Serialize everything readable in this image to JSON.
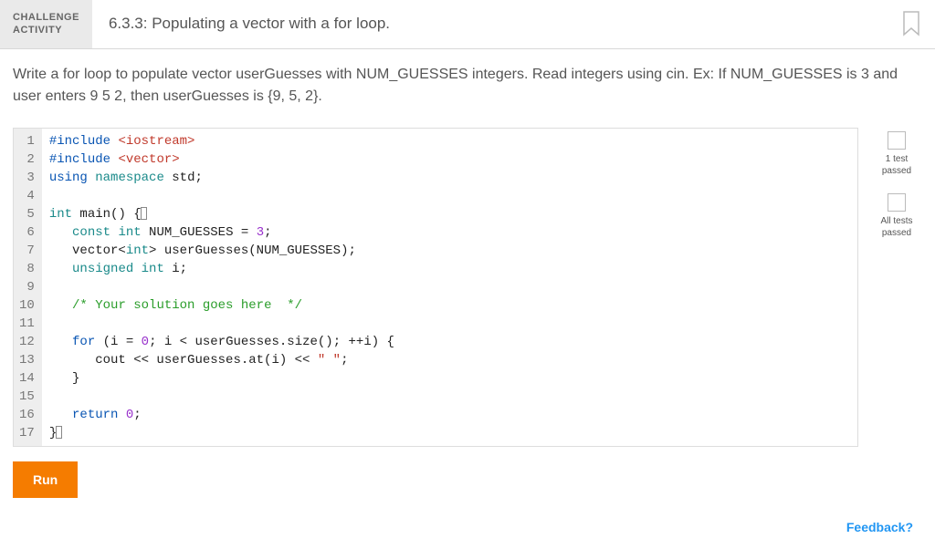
{
  "header": {
    "challenge_label_line1": "CHALLENGE",
    "challenge_label_line2": "ACTIVITY",
    "title": "6.3.3: Populating a vector with a for loop."
  },
  "instructions": "Write a for loop to populate vector userGuesses with NUM_GUESSES integers. Read integers using cin. Ex: If NUM_GUESSES is 3 and user enters 9 5 2, then userGuesses is {9, 5, 2}.",
  "code": {
    "lines": [
      {
        "n": 1,
        "tokens": [
          [
            "#include ",
            "kw-blue"
          ],
          [
            "<iostream>",
            "str-red"
          ]
        ]
      },
      {
        "n": 2,
        "tokens": [
          [
            "#include ",
            "kw-blue"
          ],
          [
            "<vector>",
            "str-red"
          ]
        ]
      },
      {
        "n": 3,
        "tokens": [
          [
            "using ",
            "kw-blue"
          ],
          [
            "namespace",
            "kw-teal"
          ],
          [
            " std;",
            ""
          ]
        ]
      },
      {
        "n": 4,
        "tokens": [
          [
            "",
            ""
          ]
        ]
      },
      {
        "n": 5,
        "tokens": [
          [
            "int",
            "kw-teal"
          ],
          [
            " main() {",
            ""
          ]
        ],
        "cursor_after_brace": true
      },
      {
        "n": 6,
        "tokens": [
          [
            "   ",
            ""
          ],
          [
            "const int",
            "kw-teal"
          ],
          [
            " NUM_GUESSES = ",
            ""
          ],
          [
            "3",
            "lit-purple"
          ],
          [
            ";",
            ""
          ]
        ]
      },
      {
        "n": 7,
        "tokens": [
          [
            "   vector<",
            ""
          ],
          [
            "int",
            "kw-teal"
          ],
          [
            "> userGuesses(NUM_GUESSES);",
            ""
          ]
        ]
      },
      {
        "n": 8,
        "tokens": [
          [
            "   ",
            ""
          ],
          [
            "unsigned int",
            "kw-teal"
          ],
          [
            " i;",
            ""
          ]
        ]
      },
      {
        "n": 9,
        "tokens": [
          [
            "",
            ""
          ]
        ]
      },
      {
        "n": 10,
        "tokens": [
          [
            "   ",
            ""
          ],
          [
            "/* Your solution goes here  */",
            "cmt-green"
          ]
        ]
      },
      {
        "n": 11,
        "tokens": [
          [
            "",
            ""
          ]
        ]
      },
      {
        "n": 12,
        "tokens": [
          [
            "   ",
            ""
          ],
          [
            "for",
            "kw-blue"
          ],
          [
            " (i = ",
            ""
          ],
          [
            "0",
            "lit-purple"
          ],
          [
            "; i < userGuesses.size(); ++i) {",
            ""
          ]
        ]
      },
      {
        "n": 13,
        "tokens": [
          [
            "      cout << userGuesses.at(i) << ",
            ""
          ],
          [
            "\" \"",
            "str-red"
          ],
          [
            ";",
            ""
          ]
        ]
      },
      {
        "n": 14,
        "tokens": [
          [
            "   }",
            ""
          ]
        ]
      },
      {
        "n": 15,
        "tokens": [
          [
            "",
            ""
          ]
        ]
      },
      {
        "n": 16,
        "tokens": [
          [
            "   ",
            ""
          ],
          [
            "return",
            "kw-blue"
          ],
          [
            " ",
            ""
          ],
          [
            "0",
            "lit-purple"
          ],
          [
            ";",
            ""
          ]
        ]
      },
      {
        "n": 17,
        "tokens": [
          [
            "}",
            ""
          ]
        ],
        "end_cursor": true
      }
    ]
  },
  "status": {
    "item1": "1 test passed",
    "item2": "All tests passed"
  },
  "run_label": "Run",
  "feedback_label": "Feedback?"
}
